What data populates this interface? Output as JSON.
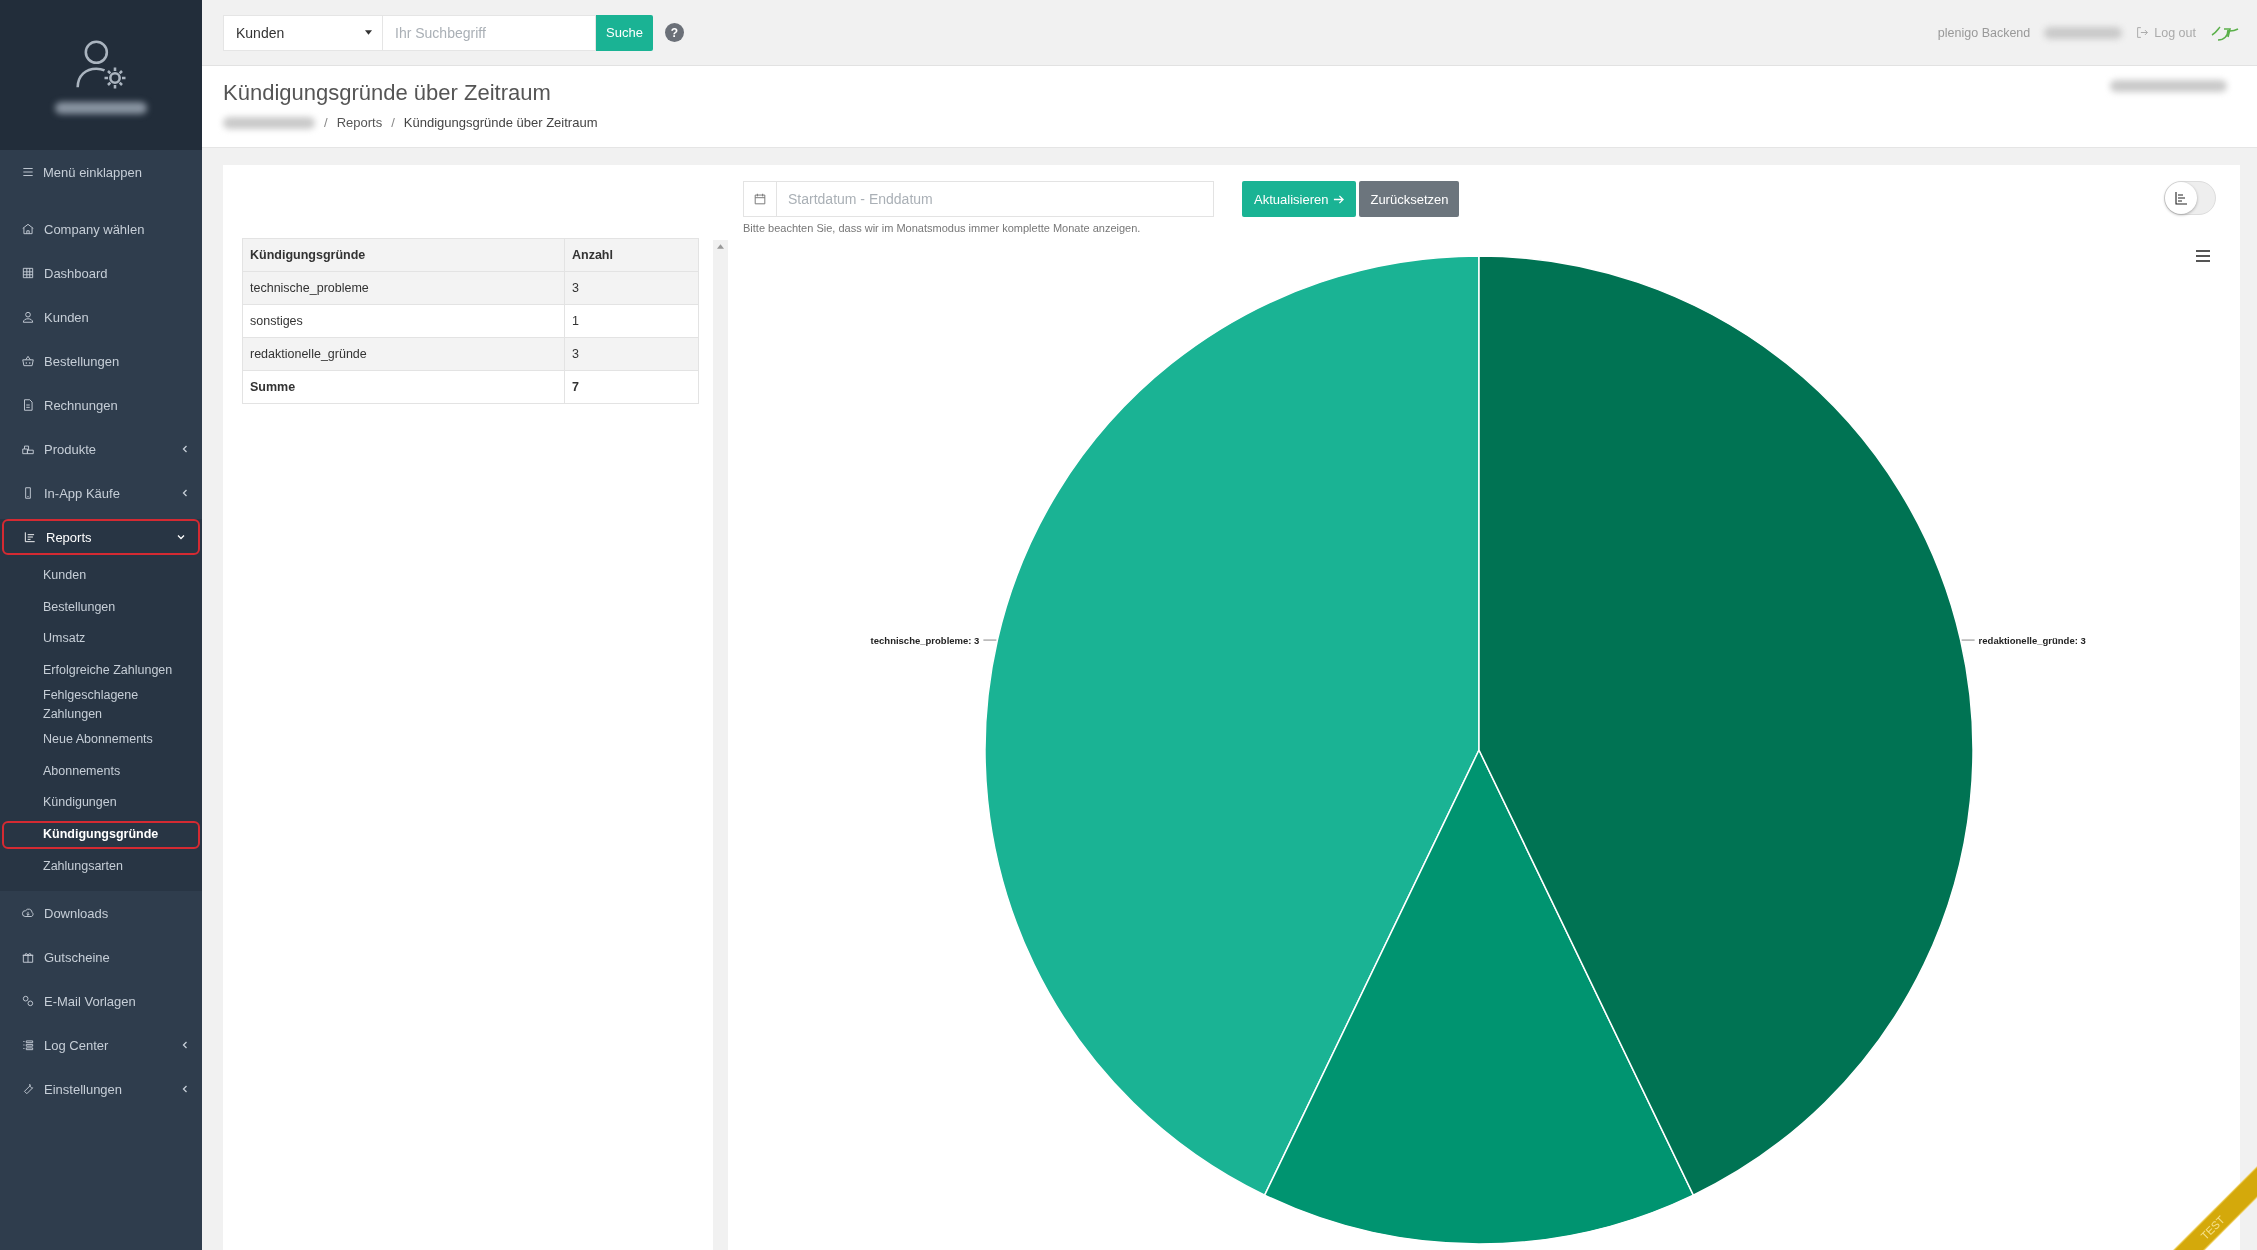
{
  "topbar": {
    "search_scope": "Kunden",
    "search": {
      "placeholder": "Ihr Suchbegriff"
    },
    "search_button": "Suche",
    "help": "?",
    "app_name": "plenigo Backend",
    "logout": "Log out"
  },
  "sidebar": {
    "collapse": "Menü einklappen",
    "items": [
      {
        "label": "Company wählen",
        "selected": false
      },
      {
        "label": "Dashboard",
        "selected": false
      },
      {
        "label": "Kunden",
        "selected": false
      },
      {
        "label": "Bestellungen",
        "selected": false
      },
      {
        "label": "Rechnungen",
        "selected": false
      },
      {
        "label": "Produkte",
        "selected": false,
        "expanded": false
      },
      {
        "label": "In-App Käufe",
        "selected": false,
        "expanded": false
      },
      {
        "label": "Reports",
        "selected": true,
        "expanded": true,
        "children": [
          {
            "label": "Kunden",
            "selected": false
          },
          {
            "label": "Bestellungen",
            "selected": false
          },
          {
            "label": "Umsatz",
            "selected": false
          },
          {
            "label": "Erfolgreiche Zahlungen",
            "selected": false
          },
          {
            "label": "Fehlgeschlagene Zahlungen",
            "selected": false
          },
          {
            "label": "Neue Abonnements",
            "selected": false
          },
          {
            "label": "Abonnements",
            "selected": false
          },
          {
            "label": "Kündigungen",
            "selected": false
          },
          {
            "label": "Kündigungsgründe",
            "selected": true
          },
          {
            "label": "Zahlungsarten",
            "selected": false
          }
        ]
      },
      {
        "label": "Downloads",
        "selected": false
      },
      {
        "label": "Gutscheine",
        "selected": false
      },
      {
        "label": "E-Mail Vorlagen",
        "selected": false
      },
      {
        "label": "Log Center",
        "selected": false,
        "expanded": false
      },
      {
        "label": "Einstellungen",
        "selected": false,
        "expanded": false
      }
    ]
  },
  "page": {
    "title": "Kündigungsgründe über Zeitraum",
    "breadcrumb": [
      {
        "kind": "separator",
        "text": "/"
      },
      {
        "kind": "link",
        "text": "Reports"
      },
      {
        "kind": "separator",
        "text": "/"
      },
      {
        "kind": "current",
        "text": "Kündigungsgründe über Zeitraum"
      }
    ]
  },
  "filters": {
    "date": {
      "placeholder": "Startdatum - Enddatum"
    },
    "apply": "Aktualisieren",
    "reset": "Zurücksetzen",
    "hint": "Bitte beachten Sie, dass wir im Monatsmodus immer komplette Monate anzeigen."
  },
  "view_toggle": {
    "on": false
  },
  "table": {
    "columns": [
      "Kündigungsgründe",
      "Anzahl"
    ],
    "rows": [
      {
        "kind": "data",
        "cells": [
          "technische_probleme",
          "3"
        ]
      },
      {
        "kind": "data",
        "cells": [
          "sonstiges",
          "1"
        ]
      },
      {
        "kind": "data",
        "cells": [
          "redaktionelle_gründe",
          "3"
        ]
      },
      {
        "kind": "total",
        "cells": [
          "Summe",
          "7"
        ]
      }
    ]
  },
  "chart_data": {
    "type": "pie",
    "values": [
      3,
      1,
      3
    ],
    "value_labels": [
      "technische_probleme: 3",
      null,
      "redaktionelle_gründe: 3"
    ]
  },
  "ribbon": "TEST"
}
